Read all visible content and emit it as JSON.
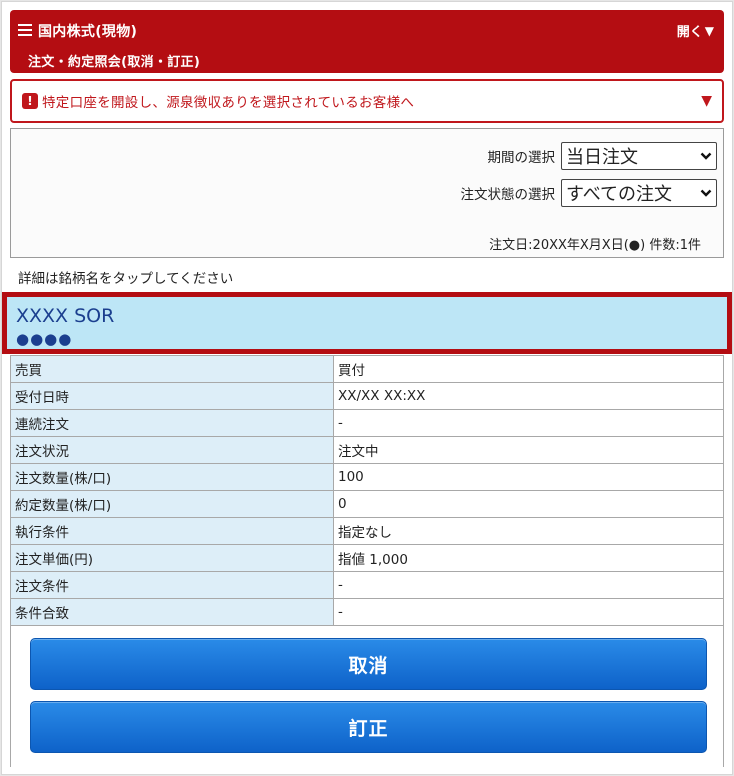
{
  "header": {
    "title": "国内株式(現物)",
    "subtitle": "注文・約定照会(取消・訂正)",
    "open_label": "開く",
    "open_icon": "triangle-down-icon"
  },
  "notice": {
    "text": "特定口座を開設し、源泉徴収ありを選択されているお客様へ",
    "icon": "alert-icon"
  },
  "filter": {
    "period_label": "期間の選択",
    "period_value": "当日注文",
    "status_label": "注文状態の選択",
    "status_value": "すべての注文",
    "meta": "注文日:20XX年X月X日(●)  件数:1件"
  },
  "hint": "詳細は銘柄名をタップしてください",
  "stock": {
    "name": "XXXX SOR",
    "code": "●●●●"
  },
  "details": [
    {
      "k": "売買",
      "v": "買付"
    },
    {
      "k": "受付日時",
      "v": "XX/XX XX:XX"
    },
    {
      "k": "連続注文",
      "v": "-"
    },
    {
      "k": "注文状況",
      "v": "注文中"
    },
    {
      "k": "注文数量(株/口)",
      "v": "100"
    },
    {
      "k": "約定数量(株/口)",
      "v": "0"
    },
    {
      "k": "執行条件",
      "v": "指定なし"
    },
    {
      "k": "注文単価(円)",
      "v": "指値 1,000"
    },
    {
      "k": "注文条件",
      "v": "-"
    },
    {
      "k": "条件合致",
      "v": "-"
    }
  ],
  "buttons": {
    "cancel": "取消",
    "modify": "訂正"
  },
  "colors": {
    "brand": "#b40d12",
    "accent": "#0e62c9",
    "row_key_bg": "#ddeef8",
    "stock_bg": "#bde6f6"
  }
}
